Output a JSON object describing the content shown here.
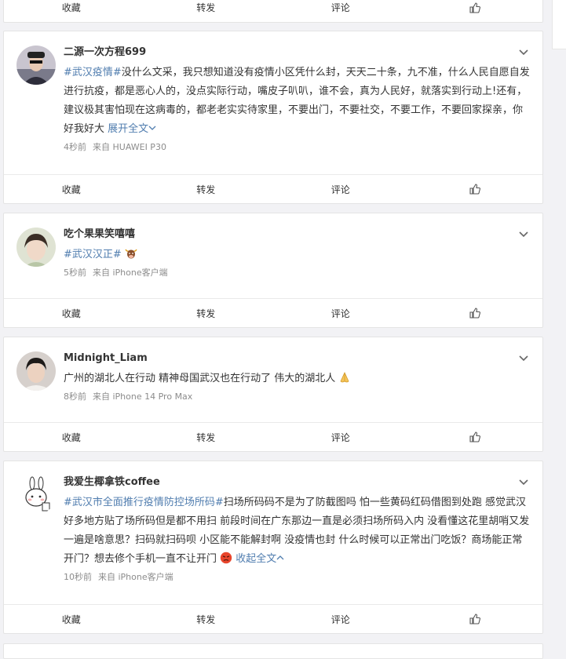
{
  "actions": {
    "collect": "收藏",
    "repost": "转发",
    "comment": "评论"
  },
  "posts": [
    {
      "name": "二源一次方程699",
      "tag": "#武汉疫情#",
      "text": "没什么文采，我只想知道没有疫情小区凭什么封，天天二十条，九不准，什么人民自愿自发进行抗疫，都是恶心人的，没点实际行动，嘴皮子叭叭，谁不会，真为人民好，就落实到行动上!还有，建议极其害怕现在这病毒的，都老老实实待家里，不要出门，不要社交，不要工作，不要回家探亲，你好我好大",
      "expand": "展开全文",
      "time": "4秒前",
      "source": "来自 HUAWEI P30"
    },
    {
      "name": "吃个果果笑嘻嘻",
      "tag": "#武汉汉正#",
      "text": "",
      "time": "5秒前",
      "source": "来自 iPhone客户端"
    },
    {
      "name": "Midnight_Liam",
      "text": "广州的湖北人在行动 精神母国武汉也在行动了 伟大的湖北人",
      "time": "8秒前",
      "source": "来自 iPhone 14 Pro Max"
    },
    {
      "name": "我爱生椰拿铁coffee",
      "tag": "#武汉市全面推行疫情防控场所码#",
      "text": "扫场所码码不是为了防截图吗 怕一些黄码红码借图到处跑 感觉武汉好多地方贴了场所码但是都不用扫 前段时间在广东那边一直是必须扫场所码入内 没看懂这花里胡哨又发一遍是啥意思？扫码就扫码呗 小区能不能解封啊 没疫情也封 什么时候可以正常出门吃饭？商场能正常开门？想去修个手机一直不让开门",
      "expand": "收起全文",
      "time": "10秒前",
      "source": "来自 iPhone客户端"
    }
  ]
}
